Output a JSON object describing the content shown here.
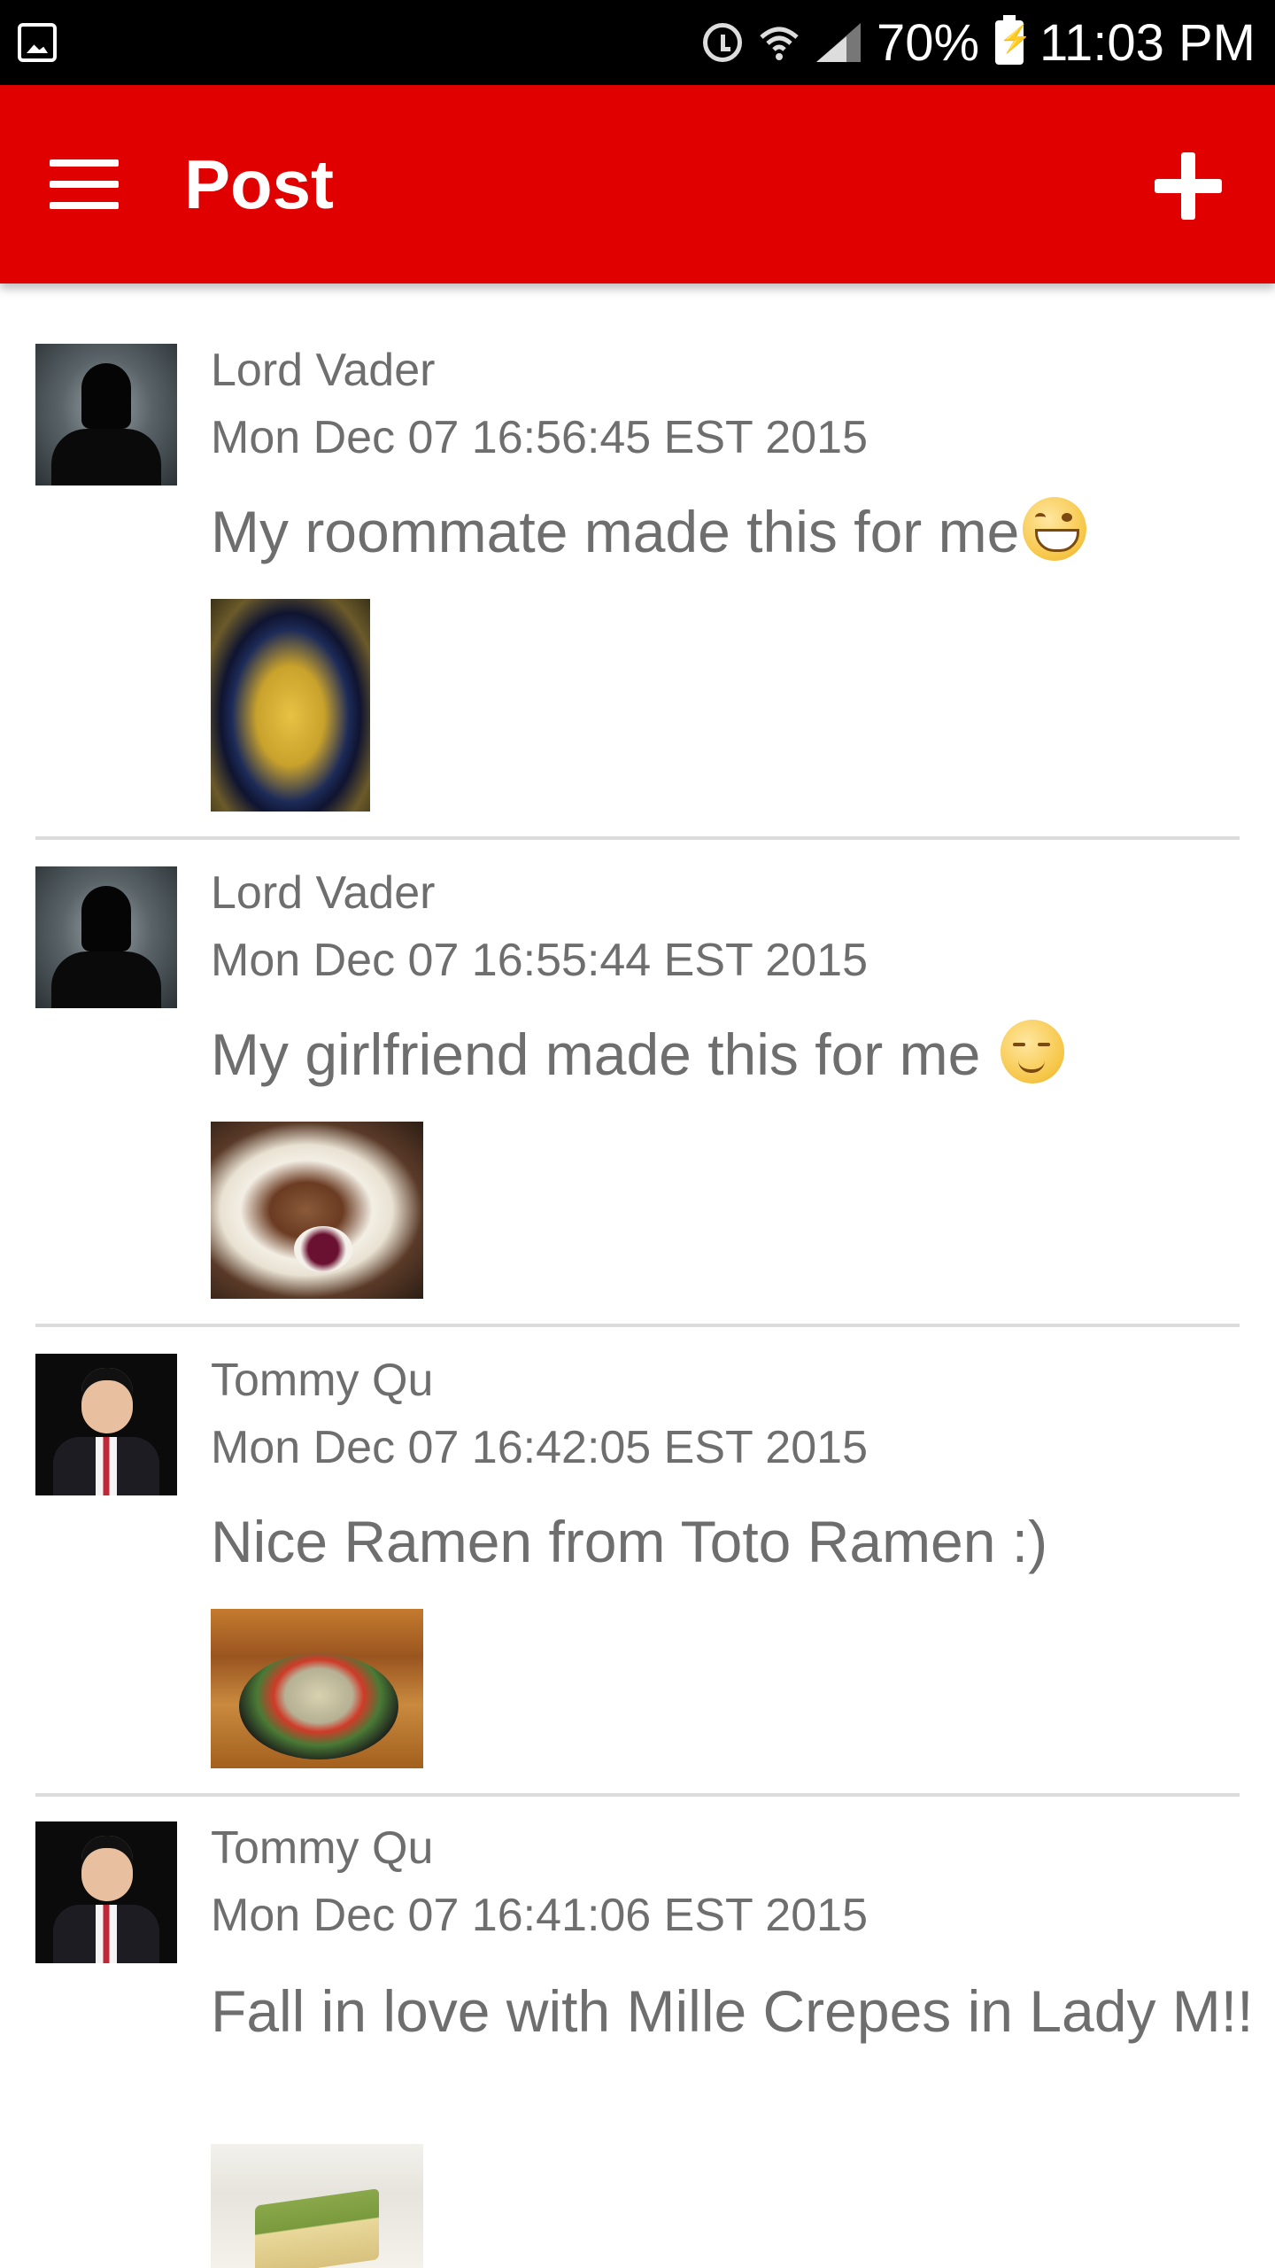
{
  "status_bar": {
    "battery": "70%",
    "time": "11:03 PM"
  },
  "app_bar": {
    "title": "Post",
    "menu_icon": "menu-icon",
    "add_icon": "add-icon"
  },
  "posts": [
    {
      "author": "Lord Vader",
      "timestamp": "Mon Dec 07 16:56:45 EST 2015",
      "message": "My roommate made this for me",
      "emoji": "grinning-face-emoji",
      "photo": "food-photo"
    },
    {
      "author": "Lord Vader",
      "timestamp": "Mon Dec 07 16:55:44 EST 2015",
      "message": "My girlfriend made this for me ",
      "emoji": "smirking-face-emoji",
      "photo": "food-photo"
    },
    {
      "author": "Tommy Qu",
      "timestamp": "Mon Dec 07 16:42:05 EST 2015",
      "message": "Nice Ramen from Toto Ramen :)",
      "photo": "food-photo"
    },
    {
      "author": "Tommy Qu",
      "timestamp": "Mon Dec 07 16:41:06 EST 2015",
      "message": "Fall in love with Mille Crepes in Lady M!!",
      "photo": "food-photo"
    }
  ],
  "colors": {
    "app_bar": "#e10000",
    "text": "#6e6e6e",
    "divider": "#dcdcdc"
  }
}
